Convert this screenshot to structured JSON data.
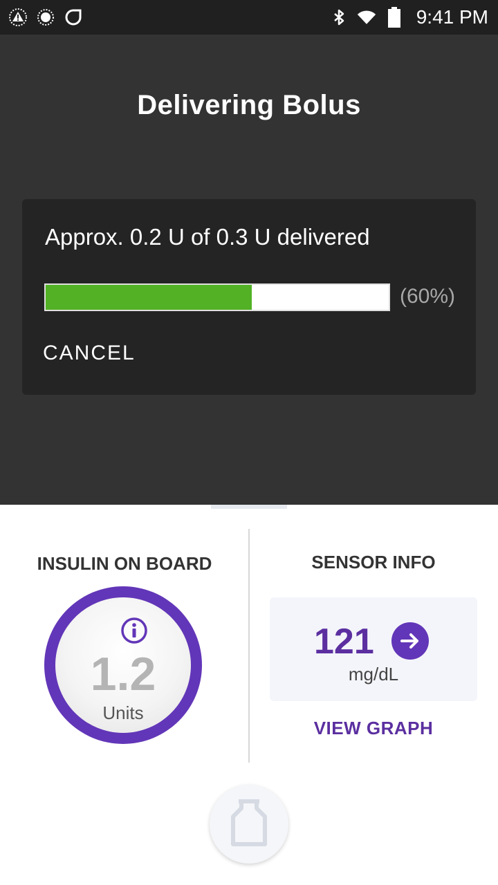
{
  "status_bar": {
    "time": "9:41 PM",
    "left_icons": [
      "alert-icon",
      "record-icon",
      "sync-icon"
    ],
    "right_icons": [
      "bluetooth-icon",
      "wifi-icon",
      "battery-icon"
    ]
  },
  "dialog": {
    "title": "Delivering Bolus",
    "progress_text": "Approx. 0.2 U of 0.3 U delivered",
    "progress_fraction": 0.6,
    "progress_label": "(60%)",
    "cancel_label": "CANCEL",
    "colors": {
      "progress_fill": "#52b125",
      "overlay": "#333333",
      "card": "#242424"
    }
  },
  "insulin_on_board": {
    "title": "INSULIN ON BOARD",
    "value": "1.2",
    "units": "Units",
    "info_icon": "info-icon",
    "ring_color": "#6236b8"
  },
  "sensor_info": {
    "title": "SENSOR INFO",
    "value": "121",
    "unit": "mg/dL",
    "arrow_icon": "arrow-right-icon",
    "link_label": "VIEW GRAPH",
    "accent_color": "#5b2fa0"
  },
  "bottom": {
    "pod_icon": "pod-icon"
  }
}
